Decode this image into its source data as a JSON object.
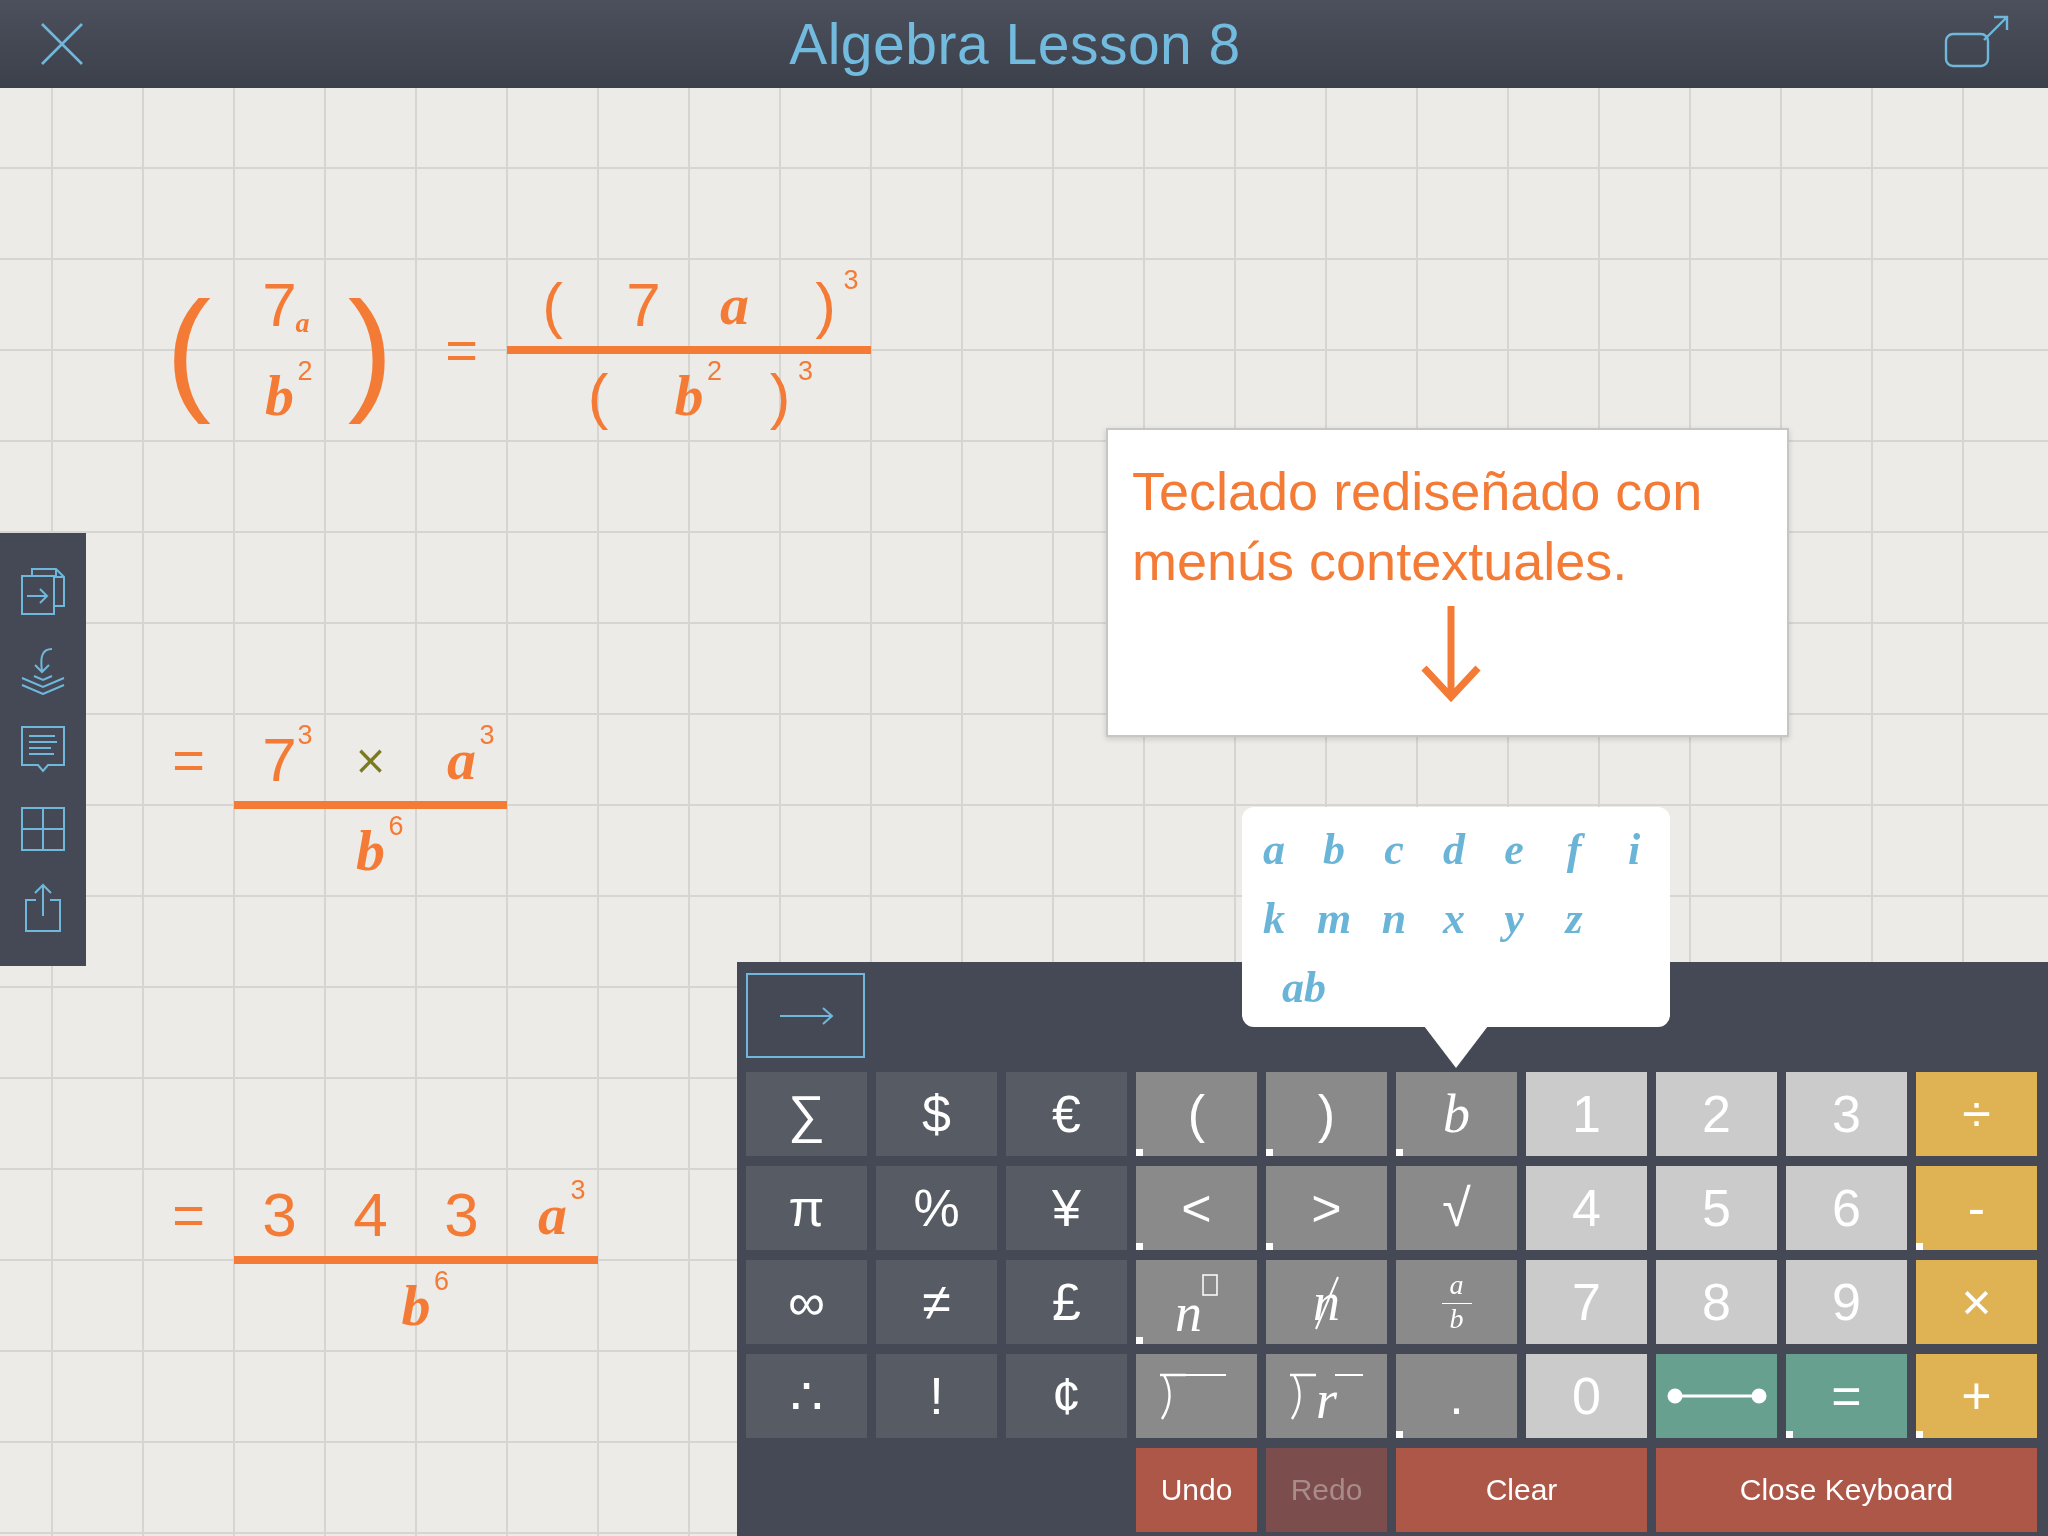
{
  "title_bar": {
    "title": "Algebra Lesson 8"
  },
  "expressions": [
    {
      "items": [
        {
          "kind": "group",
          "open": "(",
          "close": ")",
          "rows": [
            [
              {
                "kind": "num",
                "text": "7",
                "sub": "a"
              }
            ],
            [
              {
                "kind": "var",
                "text": "b",
                "sup": "2"
              }
            ]
          ]
        },
        {
          "kind": "relation",
          "text": "="
        },
        {
          "kind": "frac",
          "num": [
            {
              "kind": "paren",
              "text": "("
            },
            {
              "kind": "num",
              "text": "7"
            },
            {
              "kind": "var",
              "text": "a"
            },
            {
              "kind": "paren",
              "text": ")",
              "sup": "3"
            }
          ],
          "den": [
            {
              "kind": "paren",
              "text": "("
            },
            {
              "kind": "var",
              "text": "b",
              "sup": "2"
            },
            {
              "kind": "paren",
              "text": ")",
              "sup": "3"
            }
          ]
        }
      ]
    },
    {
      "items": [
        {
          "kind": "relation",
          "text": "="
        },
        {
          "kind": "frac",
          "num": [
            {
              "kind": "num",
              "text": "7",
              "sup": "3"
            },
            {
              "kind": "op",
              "text": "×"
            },
            {
              "kind": "var",
              "text": "a",
              "sup": "3"
            }
          ],
          "den": [
            {
              "kind": "var",
              "text": "b",
              "sup": "6"
            }
          ]
        }
      ]
    },
    {
      "items": [
        {
          "kind": "relation",
          "text": "="
        },
        {
          "kind": "frac",
          "num": [
            {
              "kind": "num",
              "text": "3"
            },
            {
              "kind": "num",
              "text": "4"
            },
            {
              "kind": "num",
              "text": "3"
            },
            {
              "kind": "var",
              "text": "a",
              "sup": "3"
            }
          ],
          "den": [
            {
              "kind": "var",
              "text": "b",
              "sup": "6"
            }
          ]
        }
      ]
    }
  ],
  "callout": {
    "text": "Teclado rediseñado con menús contextuales."
  },
  "keyboard": {
    "letter_popup": {
      "rows": [
        [
          "a",
          "b",
          "c",
          "d",
          "e",
          "f",
          "i"
        ],
        [
          "k",
          "m",
          "n",
          "x",
          "y",
          "z"
        ],
        [
          "ab"
        ]
      ]
    },
    "rows": [
      [
        {
          "kind": "text",
          "label": "∑",
          "color": "#575b64",
          "menu": false,
          "open": false
        },
        {
          "kind": "text",
          "label": "$",
          "color": "#575b64",
          "menu": false,
          "open": false
        },
        {
          "kind": "text",
          "label": "€",
          "color": "#575b64",
          "menu": false,
          "open": false
        },
        {
          "kind": "text",
          "label": "(",
          "color": "#8a8a8a",
          "menu": true,
          "open": false
        },
        {
          "kind": "text",
          "label": ")",
          "color": "#8a8a8a",
          "menu": true,
          "open": false
        },
        {
          "kind": "variable",
          "label": "b",
          "color": "#8a8a8a",
          "menu": true,
          "open": true
        },
        {
          "kind": "text",
          "label": "1",
          "color": "#cbcbcb",
          "menu": false,
          "open": false
        },
        {
          "kind": "text",
          "label": "2",
          "color": "#cbcbcb",
          "menu": false,
          "open": false
        },
        {
          "kind": "text",
          "label": "3",
          "color": "#cbcbcb",
          "menu": false,
          "open": false
        },
        {
          "kind": "text",
          "label": "÷",
          "color": "#dfb254",
          "menu": false,
          "open": false
        }
      ],
      [
        {
          "kind": "text",
          "label": "π",
          "color": "#575b64",
          "menu": false,
          "open": false
        },
        {
          "kind": "text",
          "label": "%",
          "color": "#575b64",
          "menu": false,
          "open": false
        },
        {
          "kind": "text",
          "label": "¥",
          "color": "#575b64",
          "menu": false,
          "open": false
        },
        {
          "kind": "text",
          "label": "<",
          "color": "#8a8a8a",
          "menu": true,
          "open": false
        },
        {
          "kind": "text",
          "label": ">",
          "color": "#8a8a8a",
          "menu": true,
          "open": false
        },
        {
          "kind": "text",
          "label": "√",
          "color": "#8a8a8a",
          "menu": false,
          "open": false
        },
        {
          "kind": "text",
          "label": "4",
          "color": "#cbcbcb",
          "menu": false,
          "open": false
        },
        {
          "kind": "text",
          "label": "5",
          "color": "#cbcbcb",
          "menu": false,
          "open": false
        },
        {
          "kind": "text",
          "label": "6",
          "color": "#cbcbcb",
          "menu": false,
          "open": false
        },
        {
          "kind": "text",
          "label": "-",
          "color": "#dfb254",
          "menu": true,
          "open": false
        }
      ],
      [
        {
          "kind": "text",
          "label": "∞",
          "color": "#575b64",
          "menu": false,
          "open": false
        },
        {
          "kind": "text",
          "label": "≠",
          "color": "#575b64",
          "menu": false,
          "open": false
        },
        {
          "kind": "text",
          "label": "£",
          "color": "#575b64",
          "menu": false,
          "open": false
        },
        {
          "kind": "power",
          "label": "n",
          "color": "#8a8a8a",
          "menu": true,
          "open": false
        },
        {
          "kind": "struck",
          "label": "n",
          "color": "#8a8a8a",
          "menu": false,
          "open": false
        },
        {
          "kind": "fraction",
          "top": "a",
          "bottom": "b",
          "color": "#8a8a8a",
          "menu": false,
          "open": false
        },
        {
          "kind": "text",
          "label": "7",
          "color": "#cbcbcb",
          "menu": false,
          "open": false
        },
        {
          "kind": "text",
          "label": "8",
          "color": "#cbcbcb",
          "menu": false,
          "open": false
        },
        {
          "kind": "text",
          "label": "9",
          "color": "#cbcbcb",
          "menu": false,
          "open": false
        },
        {
          "kind": "text",
          "label": "×",
          "color": "#dfb254",
          "menu": false,
          "open": false
        }
      ],
      [
        {
          "kind": "text",
          "label": "∴",
          "color": "#575b64",
          "menu": false,
          "open": false
        },
        {
          "kind": "text",
          "label": "!",
          "color": "#575b64",
          "menu": false,
          "open": false
        },
        {
          "kind": "text",
          "label": "¢",
          "color": "#575b64",
          "menu": false,
          "open": false
        },
        {
          "kind": "division",
          "color": "#8a8a8a",
          "menu": false,
          "open": false
        },
        {
          "kind": "division",
          "label": "r",
          "color": "#8a8a8a",
          "menu": false,
          "open": false
        },
        {
          "kind": "text",
          "label": ".",
          "color": "#8a8a8a",
          "menu": true,
          "open": false
        },
        {
          "kind": "text",
          "label": "0",
          "color": "#cbcbcb",
          "menu": false,
          "open": false
        },
        {
          "kind": "segment",
          "color": "#68a08f",
          "menu": false,
          "open": false
        },
        {
          "kind": "text",
          "label": "=",
          "color": "#68a08f",
          "menu": true,
          "open": false
        },
        {
          "kind": "text",
          "label": "+",
          "color": "#dfb254",
          "menu": true,
          "open": false
        }
      ]
    ],
    "actions": [
      {
        "label": "Undo",
        "disabled": false
      },
      {
        "label": "Redo",
        "disabled": true
      },
      {
        "label": "Clear",
        "disabled": false
      },
      {
        "label": "Close Keyboard",
        "disabled": false
      }
    ]
  }
}
